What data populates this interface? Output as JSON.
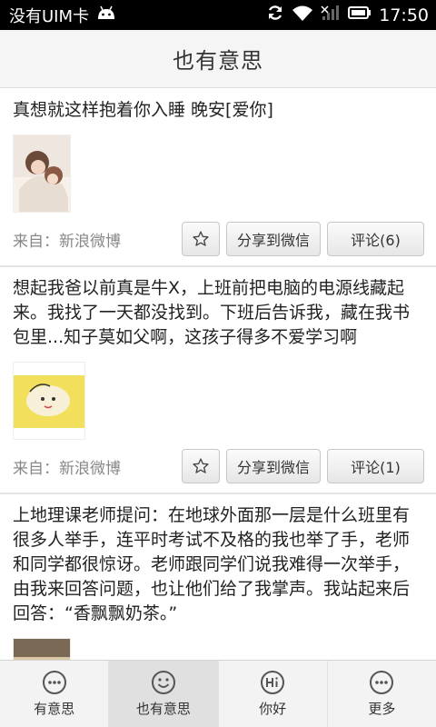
{
  "status_bar": {
    "carrier": "没有UIM卡",
    "time": "17:50"
  },
  "title": "也有意思",
  "posts": [
    {
      "text": "真想就这样抱着你入睡 晚安[爱你]",
      "source": "来自：新浪微博",
      "share_label": "分享到微信",
      "comment_label": "评论(6)"
    },
    {
      "text": "想起我爸以前真是牛X，上班前把电脑的电源线藏起来。我找了一天都没找到。下班后告诉我，藏在我书包里...知子莫如父啊，这孩子得多不爱学习啊",
      "source": "来自：新浪微博",
      "share_label": "分享到微信",
      "comment_label": "评论(1)"
    },
    {
      "text": "上地理课老师提问：在地球外面那一层是什么班里有很多人举手，连平时考试不及格的我也举了手，老师和同学都很惊讶。老师跟同学们说我难得一次举手，由我来回答问题，也让他们给了我掌声。我站起来后回答：“香飘飘奶茶。”"
    }
  ],
  "tabs": [
    {
      "label": "有意思",
      "icon": "chat-dots-icon",
      "active": false
    },
    {
      "label": "也有意思",
      "icon": "smiley-icon",
      "active": true
    },
    {
      "label": "你好",
      "icon": "hi-icon",
      "active": false
    },
    {
      "label": "更多",
      "icon": "more-dots-icon",
      "active": false
    }
  ],
  "colors": {
    "status_bar_bg": "#000000",
    "title_bar_bg": "#f5f5f5",
    "tab_active_bg": "#e0e0e0"
  }
}
